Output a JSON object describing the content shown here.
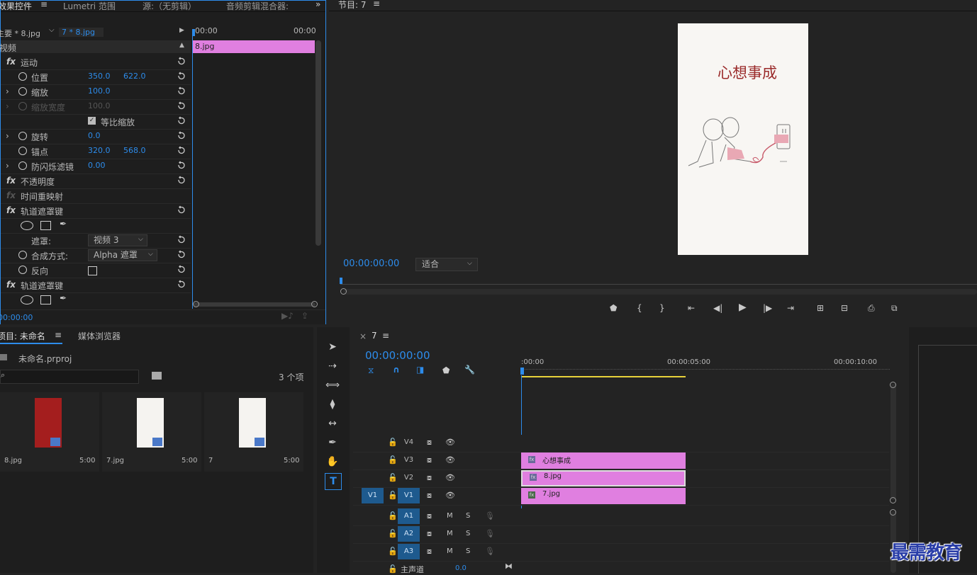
{
  "effect_controls": {
    "tabs": [
      "效果控件",
      "Lumetri 范围",
      "源:（无剪辑）",
      "音频剪辑混合器:"
    ],
    "master_clip": "主要 * 8.jpg",
    "sequence_clip": "7 * 8.jpg",
    "time_start": "00:00",
    "time_end": "00:00",
    "clip_name": "8.jpg",
    "section_video": "视频",
    "rows": [
      {
        "label": "运动"
      },
      {
        "label": "位置",
        "v1": "350.0",
        "v2": "622.0"
      },
      {
        "label": "缩放",
        "v1": "100.0"
      },
      {
        "label": "缩放宽度",
        "v1": "100.0"
      },
      {
        "label": "等比缩放"
      },
      {
        "label": "旋转",
        "v1": "0.0"
      },
      {
        "label": "锚点",
        "v1": "320.0",
        "v2": "568.0"
      },
      {
        "label": "防闪烁滤镜",
        "v1": "0.00"
      },
      {
        "label": "不透明度"
      },
      {
        "label": "时间重映射"
      },
      {
        "label": "轨道遮罩键"
      },
      {
        "label": "遮罩:",
        "select": "视频 3"
      },
      {
        "label": "合成方式:",
        "select": "Alpha 遮罩"
      },
      {
        "label": "反向"
      },
      {
        "label": "轨道遮罩键"
      }
    ],
    "fx_symbol": "fx",
    "bottom_timecode": "00:00:00"
  },
  "program": {
    "title": "节目: 7",
    "menu_icon": "≡",
    "preview_text": "心想事成",
    "timecode": "00:00:00:00",
    "fit_label": "适合"
  },
  "project": {
    "tabs": [
      "项目: 未命名",
      "媒体浏览器"
    ],
    "file": "未命名.prproj",
    "item_count": "3 个项",
    "items": [
      {
        "name": "8.jpg",
        "dur": "5:00"
      },
      {
        "name": "7.jpg",
        "dur": "5:00"
      },
      {
        "name": "7",
        "dur": "5:00"
      }
    ]
  },
  "timeline": {
    "close": "×",
    "name": "7",
    "menu_icon": "≡",
    "timecode": "00:00:00:00",
    "ruler": [
      ":00:00",
      "00:00:05:00",
      "00:00:10:00"
    ],
    "tracks": [
      {
        "name": "V4"
      },
      {
        "name": "V3"
      },
      {
        "name": "V2"
      },
      {
        "name": "V1",
        "src": "V1"
      }
    ],
    "audio_tracks": [
      {
        "name": "A1"
      },
      {
        "name": "A2"
      },
      {
        "name": "A3"
      }
    ],
    "mute": "M",
    "solo": "S",
    "master": {
      "label": "主声道",
      "value": "0.0"
    },
    "clips": [
      {
        "label": "心想事成"
      },
      {
        "label": "8.jpg"
      },
      {
        "label": "7.jpg"
      }
    ]
  },
  "watermark": "最需教育",
  "colors": {
    "accent": "#2d8ceb",
    "clip": "#e07fe0",
    "background": "#232323"
  }
}
